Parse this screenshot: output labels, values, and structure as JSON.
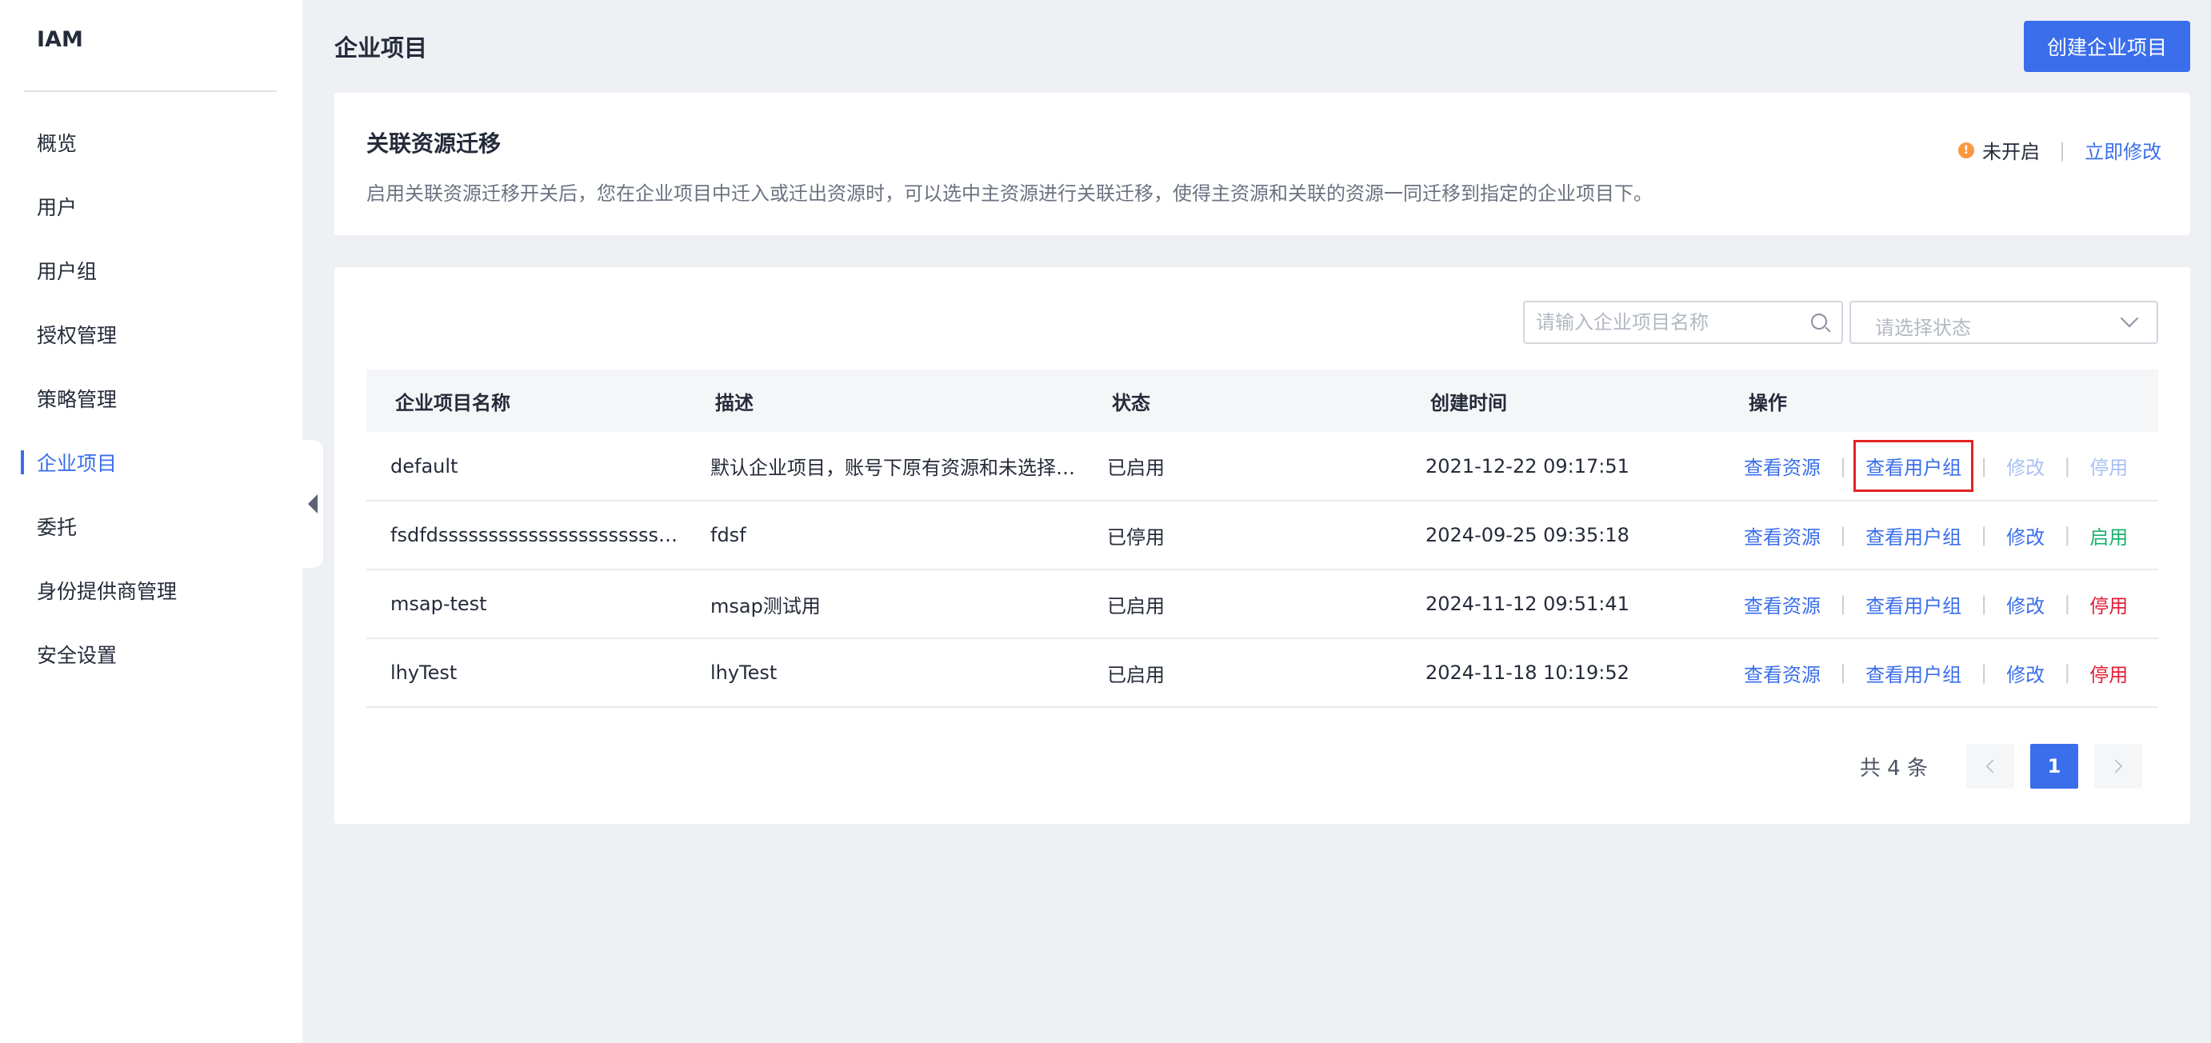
{
  "sidebar": {
    "brand": "IAM",
    "items": [
      {
        "label": "概览",
        "active": false
      },
      {
        "label": "用户",
        "active": false
      },
      {
        "label": "用户组",
        "active": false
      },
      {
        "label": "授权管理",
        "active": false
      },
      {
        "label": "策略管理",
        "active": false
      },
      {
        "label": "企业项目",
        "active": true
      },
      {
        "label": "委托",
        "active": false
      },
      {
        "label": "身份提供商管理",
        "active": false
      },
      {
        "label": "安全设置",
        "active": false
      }
    ]
  },
  "header": {
    "title": "企业项目",
    "create_button": "创建企业项目"
  },
  "migration": {
    "title": "关联资源迁移",
    "description": "启用关联资源迁移开关后，您在企业项目中迁入或迁出资源时，可以选中主资源进行关联迁移，使得主资源和关联的资源一同迁移到指定的企业项目下。",
    "status_text": "未开启",
    "status_icon_glyph": "!",
    "edit_link": "立即修改"
  },
  "filters": {
    "search_placeholder": "请输入企业项目名称",
    "status_placeholder": "请选择状态"
  },
  "table": {
    "columns": [
      "企业项目名称",
      "描述",
      "状态",
      "创建时间",
      "操作"
    ],
    "rows": [
      {
        "name": "default",
        "description": "默认企业项目，账号下原有资源和未选择企业项目的资源均在默认企业项目内。",
        "status": "已启用",
        "created": "2021-12-22 09:17:51",
        "ops": {
          "view_resources": "查看资源",
          "view_groups": "查看用户组",
          "edit": "修改",
          "toggle": "停用"
        }
      },
      {
        "name": "fsdfdsssssssssssssssssssssssssss",
        "description": "fdsf",
        "status": "已停用",
        "created": "2024-09-25 09:35:18",
        "ops": {
          "view_resources": "查看资源",
          "view_groups": "查看用户组",
          "edit": "修改",
          "toggle": "启用"
        }
      },
      {
        "name": "msap-test",
        "description": "msap测试用",
        "status": "已启用",
        "created": "2024-11-12 09:51:41",
        "ops": {
          "view_resources": "查看资源",
          "view_groups": "查看用户组",
          "edit": "修改",
          "toggle": "停用"
        }
      },
      {
        "name": "lhyTest",
        "description": "lhyTest",
        "status": "已启用",
        "created": "2024-11-18 10:19:52",
        "ops": {
          "view_resources": "查看资源",
          "view_groups": "查看用户组",
          "edit": "修改",
          "toggle": "停用"
        }
      }
    ],
    "op_separator": "|"
  },
  "pagination": {
    "total_prefix": "共",
    "total_count": "4",
    "total_suffix": "条",
    "current_page": "1"
  },
  "colors": {
    "primary": "#3a6eeb",
    "enabled": "#18b26b",
    "disabled": "#e02038",
    "warning": "#fa9841",
    "highlight": "#e52222"
  }
}
